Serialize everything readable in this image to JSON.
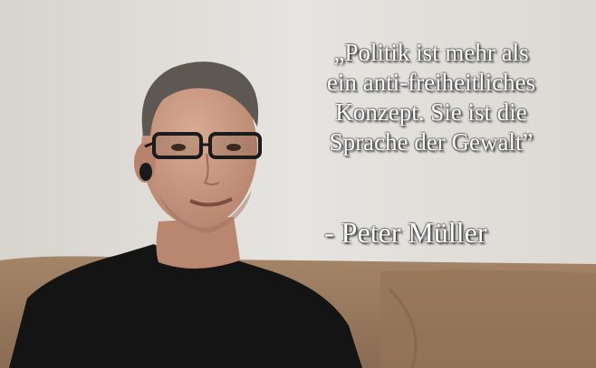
{
  "quote": {
    "lines": [
      "„Politik ist mehr als",
      "ein anti-freiheitliches",
      "Konzept. Sie ist die",
      "Sprache der Gewalt”"
    ]
  },
  "author": "- Peter Müller",
  "colors": {
    "wall": "#e4e2de",
    "couch": "#9a7a60",
    "shirt": "#151515",
    "skin": "#c89880",
    "hair": "#5a5550",
    "text": "#ffffff"
  }
}
